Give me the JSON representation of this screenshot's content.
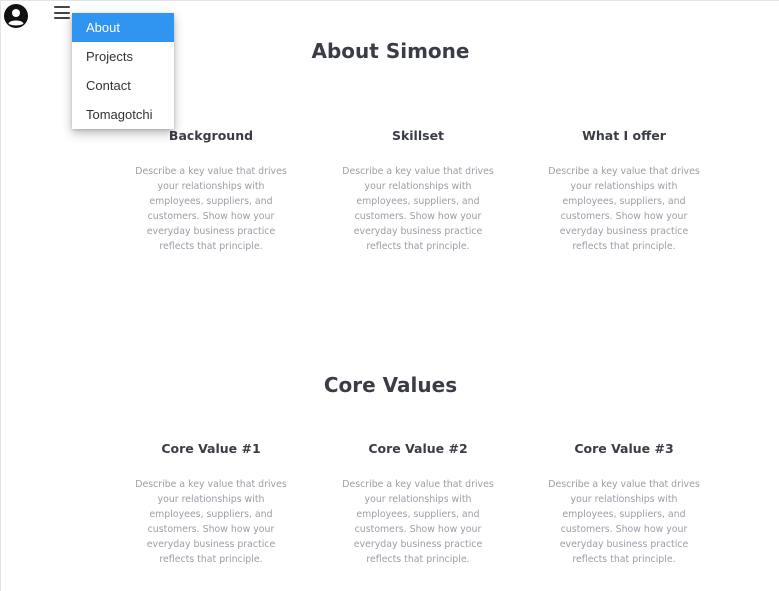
{
  "nav": {
    "account_icon": "account-circle-icon",
    "menu_icon": "hamburger-menu-icon",
    "menu_items": [
      "About",
      "Projects",
      "Contact",
      "Tomagotchi"
    ],
    "active_color": "#2f95f0"
  },
  "about": {
    "title": "About Simone",
    "columns": [
      {
        "heading": "Background",
        "text": "Describe a key value that drives your relationships with employees, suppliers, and customers. Show how your everyday business practice reflects that principle."
      },
      {
        "heading": "Skillset",
        "text": "Describe a key value that drives your relationships with employees, suppliers, and customers. Show how your everyday business practice reflects that principle."
      },
      {
        "heading": "What I offer",
        "text": "Describe a key value that drives your relationships with employees, suppliers, and customers. Show how your everyday business practice reflects that principle."
      }
    ]
  },
  "core_values": {
    "title": "Core Values",
    "columns": [
      {
        "heading": "Core Value #1",
        "text": "Describe a key value that drives your relationships with employees, suppliers, and customers. Show how your everyday business practice reflects that principle."
      },
      {
        "heading": "Core Value #2",
        "text": "Describe a key value that drives your relationships with employees, suppliers, and customers. Show how your everyday business practice reflects that principle."
      },
      {
        "heading": "Core Value #3",
        "text": "Describe a key value that drives your relationships with employees, suppliers, and customers. Show how your everyday business practice reflects that principle."
      }
    ]
  }
}
